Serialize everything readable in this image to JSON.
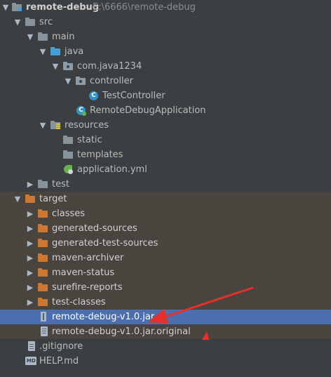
{
  "project": {
    "name": "remote-debug",
    "path": "E:\\6666\\remote-debug"
  },
  "colors": {
    "background": "#3c3f41",
    "excluded_background": "#49453e",
    "selection": "#4b6eaf",
    "source_folder": "#4a9ed6",
    "package_folder": "#8c9ba8",
    "plain_folder": "#87939a",
    "excluded_folder": "#cc7832",
    "class_icon": "#3592c4",
    "annotation_arrow": "#e8302a"
  },
  "tree": {
    "src": "src",
    "main": "main",
    "java": "java",
    "package": "com.java1234",
    "controller": "controller",
    "test_controller": "TestController",
    "app_class": "RemoteDebugApplication",
    "resources": "resources",
    "static": "static",
    "templates": "templates",
    "application_yml": "application.yml",
    "test": "test",
    "target": "target",
    "classes": "classes",
    "generated_sources": "generated-sources",
    "generated_test_sources": "generated-test-sources",
    "maven_archiver": "maven-archiver",
    "maven_status": "maven-status",
    "surefire_reports": "surefire-reports",
    "test_classes": "test-classes",
    "jar": "remote-debug-v1.0.jar",
    "jar_original": "remote-debug-v1.0.jar.original",
    "gitignore": ".gitignore",
    "help_md": "HELP.md"
  },
  "icons": {
    "expanded": "triangle-down",
    "collapsed": "triangle-right"
  }
}
